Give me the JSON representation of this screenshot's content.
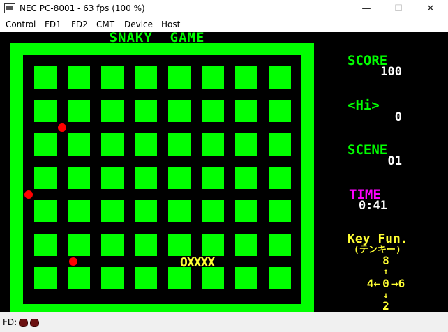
{
  "window": {
    "title": "NEC PC-8001 - 63 fps (100 %)",
    "minimize": "—",
    "maximize": "☐",
    "close": "✕"
  },
  "menu": [
    "Control",
    "FD1",
    "FD2",
    "CMT",
    "Device",
    "Host"
  ],
  "game": {
    "title": "SNAKY  GAME",
    "score_label": "SCORE",
    "score": "100",
    "hi_label": "<Hi>",
    "hi": "0",
    "scene_label": "SCENE",
    "scene": "01",
    "time_label": "TIME",
    "time": "0:41",
    "keyfun_label": "Key Fun.",
    "tenkey_label": "(テンキー)",
    "key_up": "8",
    "key_left": "4←",
    "key_center": "0",
    "key_right": "→6",
    "key_down": "2",
    "snake": "OXXXX",
    "colors": {
      "green": "#00ff00",
      "magenta": "#ff00ff",
      "yellow": "#ffff33",
      "red": "#ff0000",
      "background": "#000000"
    }
  },
  "status": {
    "fd_label": "FD:"
  }
}
